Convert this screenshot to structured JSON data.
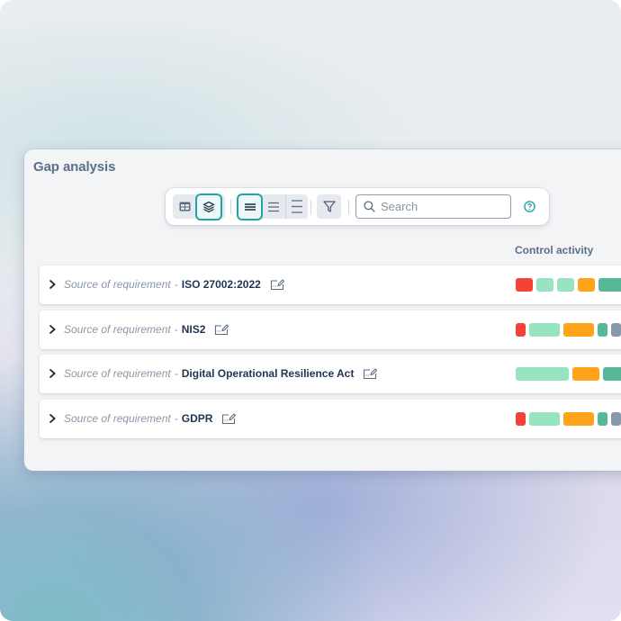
{
  "panel": {
    "title": "Gap analysis"
  },
  "toolbar": {
    "view_group": [
      {
        "icon": "table-icon",
        "active": false
      },
      {
        "icon": "layers-icon",
        "active": true
      }
    ],
    "density_group": [
      {
        "icon": "density-compact-icon",
        "active": true
      },
      {
        "icon": "density-standard-icon",
        "active": false
      },
      {
        "icon": "density-comfortable-icon",
        "active": false
      }
    ],
    "filter_icon": "filter-icon",
    "search": {
      "placeholder": "Search",
      "value": "",
      "icon": "search-icon"
    },
    "help_icon": "help-icon"
  },
  "table": {
    "column_header": "Control activity",
    "colors": {
      "red": "#f44336",
      "light_green": "#98e3c0",
      "orange": "#ffa31a",
      "green": "#57b897",
      "grey": "#8899aa"
    },
    "rows": [
      {
        "prefix": "Source of requirement",
        "separator": "-",
        "name": "ISO 27002:2022",
        "segments": [
          {
            "color": "red",
            "size": 1
          },
          {
            "color": "light_green",
            "size": 1
          },
          {
            "color": "light_green",
            "size": 1
          },
          {
            "color": "orange",
            "size": 1
          },
          {
            "color": "green",
            "size": 1.6
          }
        ]
      },
      {
        "prefix": "Source of requirement",
        "separator": "-",
        "name": "NIS2",
        "segments": [
          {
            "color": "red",
            "size": 0.6
          },
          {
            "color": "light_green",
            "size": 1.8
          },
          {
            "color": "orange",
            "size": 1.8
          },
          {
            "color": "green",
            "size": 0.6
          },
          {
            "color": "grey",
            "size": 0.6
          }
        ]
      },
      {
        "prefix": "Source of requirement",
        "separator": "-",
        "name": "Digital Operational Resilience Act",
        "segments": [
          {
            "color": "light_green",
            "size": 3.1
          },
          {
            "color": "orange",
            "size": 1.6
          },
          {
            "color": "green",
            "size": 1.2
          }
        ]
      },
      {
        "prefix": "Source of requirement",
        "separator": "-",
        "name": "GDPR",
        "segments": [
          {
            "color": "red",
            "size": 0.6
          },
          {
            "color": "light_green",
            "size": 1.8
          },
          {
            "color": "orange",
            "size": 1.8
          },
          {
            "color": "green",
            "size": 0.6
          },
          {
            "color": "grey",
            "size": 0.6
          }
        ]
      }
    ]
  }
}
